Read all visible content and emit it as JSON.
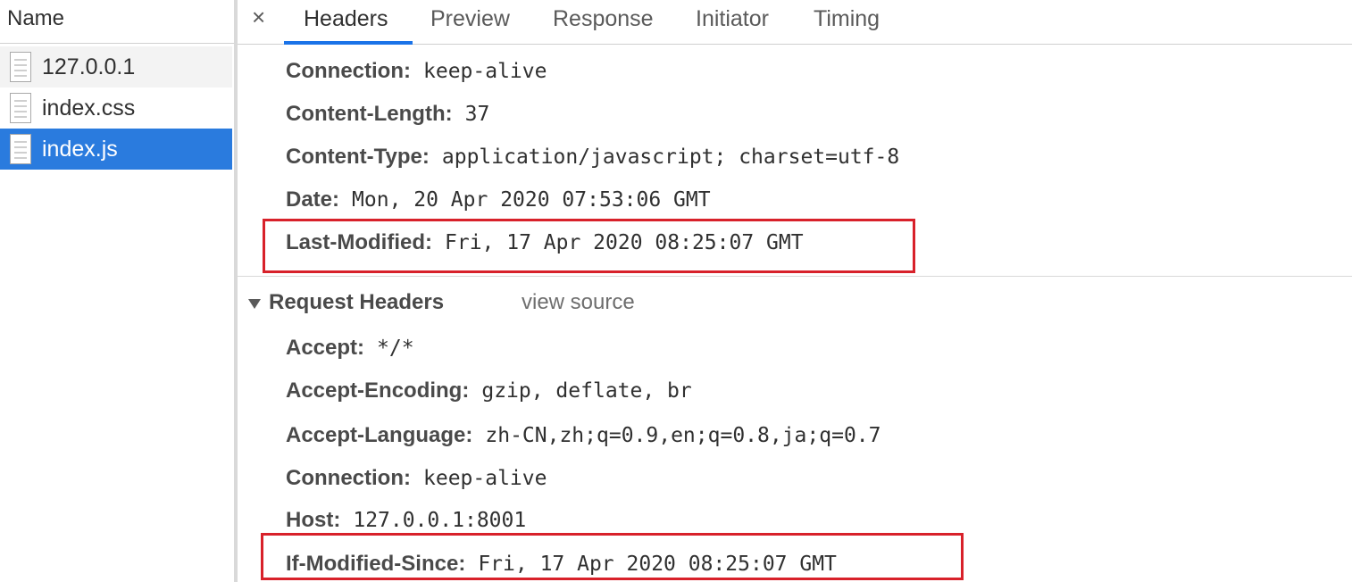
{
  "left_panel": {
    "header": "Name",
    "files": [
      {
        "name": "127.0.0.1"
      },
      {
        "name": "index.css"
      },
      {
        "name": "index.js"
      }
    ]
  },
  "tabs": {
    "close_icon": "×",
    "items": [
      {
        "label": "Headers"
      },
      {
        "label": "Preview"
      },
      {
        "label": "Response"
      },
      {
        "label": "Initiator"
      },
      {
        "label": "Timing"
      }
    ],
    "active": "Headers"
  },
  "response_headers": [
    {
      "key": "Connection",
      "value": "keep-alive"
    },
    {
      "key": "Content-Length",
      "value": "37"
    },
    {
      "key": "Content-Type",
      "value": "application/javascript; charset=utf-8"
    },
    {
      "key": "Date",
      "value": "Mon, 20 Apr 2020 07:53:06 GMT"
    },
    {
      "key": "Last-Modified",
      "value": "Fri, 17 Apr 2020 08:25:07 GMT"
    }
  ],
  "request_section": {
    "title": "Request Headers",
    "view_source": "view source"
  },
  "request_headers": [
    {
      "key": "Accept",
      "value": "*/*"
    },
    {
      "key": "Accept-Encoding",
      "value": "gzip, deflate, br"
    },
    {
      "key": "Accept-Language",
      "value": "zh-CN,zh;q=0.9,en;q=0.8,ja;q=0.7"
    },
    {
      "key": "Connection",
      "value": "keep-alive"
    },
    {
      "key": "Host",
      "value": "127.0.0.1:8001"
    },
    {
      "key": "If-Modified-Since",
      "value": "Fri, 17 Apr 2020 08:25:07 GMT"
    }
  ],
  "colors": {
    "selected_row": "#2a7bde",
    "active_tab_underline": "#1a73e8",
    "highlight_box": "#d8212a"
  }
}
